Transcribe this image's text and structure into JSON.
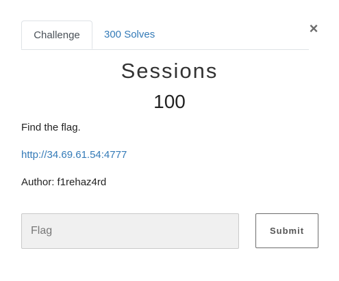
{
  "modal": {
    "close_label": "×"
  },
  "tabs": [
    {
      "label": "Challenge",
      "active": true
    },
    {
      "label": "300 Solves",
      "active": false
    }
  ],
  "challenge": {
    "name": "Sessions",
    "value": "100",
    "description": "Find the flag.",
    "link": "http://34.69.61.54:4777",
    "author": "Author: f1rehaz4rd"
  },
  "submission": {
    "flag_placeholder": "Flag",
    "flag_value": "",
    "submit_label": "Submit"
  },
  "colors": {
    "link": "#337ab7",
    "tab_border": "#dee2e6",
    "input_bg": "#f0f0f0"
  }
}
